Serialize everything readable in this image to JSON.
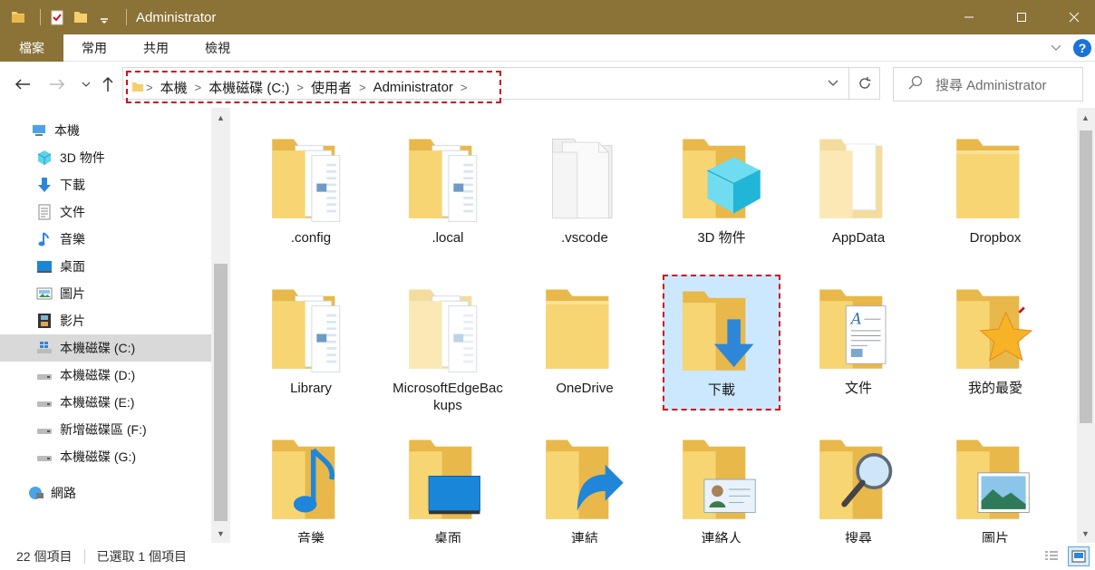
{
  "window": {
    "title": "Administrator"
  },
  "ribbon": {
    "tabs": [
      "檔案",
      "常用",
      "共用",
      "檢視"
    ]
  },
  "address": {
    "crumbs": [
      "本機",
      "本機磁碟 (C:)",
      "使用者",
      "Administrator"
    ],
    "search_placeholder": "搜尋 Administrator"
  },
  "nav": {
    "items": [
      {
        "label": "本機",
        "icon": "this-pc-icon"
      },
      {
        "label": "3D 物件",
        "icon": "3d-objects-icon"
      },
      {
        "label": "下載",
        "icon": "downloads-icon"
      },
      {
        "label": "文件",
        "icon": "documents-icon"
      },
      {
        "label": "音樂",
        "icon": "music-icon"
      },
      {
        "label": "桌面",
        "icon": "desktop-icon"
      },
      {
        "label": "圖片",
        "icon": "pictures-icon"
      },
      {
        "label": "影片",
        "icon": "videos-icon"
      },
      {
        "label": "本機磁碟 (C:)",
        "icon": "windows-drive-icon",
        "selected": true
      },
      {
        "label": "本機磁碟 (D:)",
        "icon": "drive-icon"
      },
      {
        "label": "本機磁碟 (E:)",
        "icon": "drive-icon"
      },
      {
        "label": "新增磁碟區 (F:)",
        "icon": "drive-icon"
      },
      {
        "label": "本機磁碟 (G:)",
        "icon": "drive-icon"
      },
      {
        "label": "網路",
        "icon": "network-icon"
      }
    ]
  },
  "files": [
    {
      "label": ".config",
      "icon": "folder-docs"
    },
    {
      "label": ".local",
      "icon": "folder-docs"
    },
    {
      "label": ".vscode",
      "icon": "folder-white"
    },
    {
      "label": "3D 物件",
      "icon": "folder-3d"
    },
    {
      "label": "AppData",
      "icon": "folder-faded"
    },
    {
      "label": "Dropbox",
      "icon": "folder"
    },
    {
      "label": "Library",
      "icon": "folder-docs"
    },
    {
      "label": "MicrosoftEdgeBackups",
      "icon": "folder-docs-faded"
    },
    {
      "label": "OneDrive",
      "icon": "folder"
    },
    {
      "label": "下載",
      "icon": "folder-download",
      "selected": true
    },
    {
      "label": "文件",
      "icon": "folder-document"
    },
    {
      "label": "我的最愛",
      "icon": "folder-star"
    },
    {
      "label": "音樂",
      "icon": "folder-music"
    },
    {
      "label": "桌面",
      "icon": "folder-desktop"
    },
    {
      "label": "連結",
      "icon": "folder-link"
    },
    {
      "label": "連絡人",
      "icon": "folder-contact"
    },
    {
      "label": "搜尋",
      "icon": "folder-search"
    },
    {
      "label": "圖片",
      "icon": "folder-picture"
    }
  ],
  "status": {
    "count": "22 個項目",
    "selected": "已選取 1 個項目"
  },
  "colors": {
    "titlebar": "#8b7236",
    "selection": "#cce8ff",
    "highlight": "#d0101a",
    "folder": "#f4cf6b"
  }
}
